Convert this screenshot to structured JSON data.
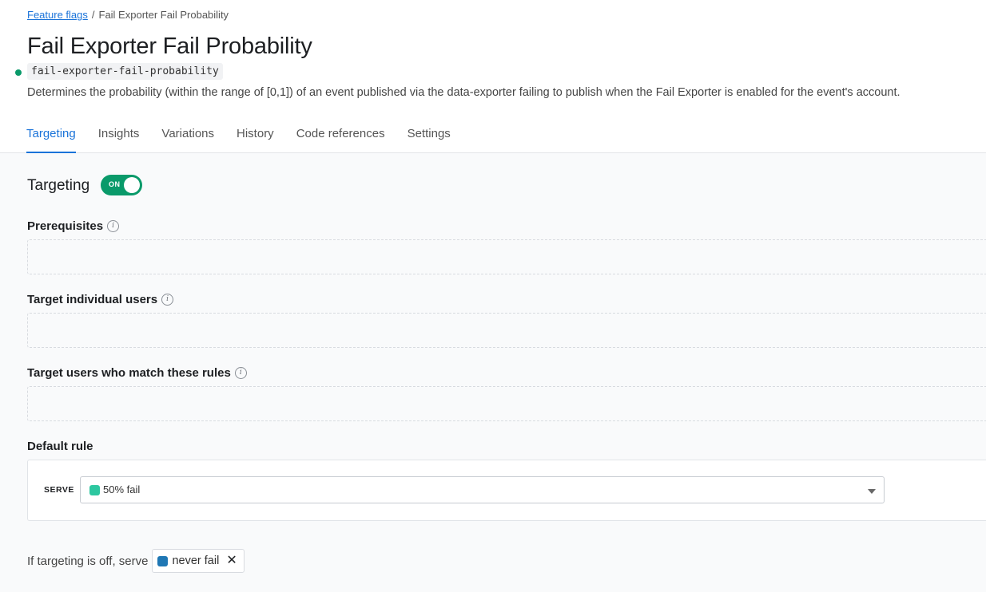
{
  "breadcrumb": {
    "parent": "Feature flags",
    "separator": "/",
    "current": "Fail Exporter Fail Probability"
  },
  "flag": {
    "title": "Fail Exporter Fail Probability",
    "key": "fail-exporter-fail-probability",
    "status_color": "#0a9a6a",
    "description": "Determines the probability (within the range of [0,1]) of an event published via the data-exporter failing to publish when the Fail Exporter is enabled for the event's account."
  },
  "tabs": [
    {
      "label": "Targeting",
      "active": true
    },
    {
      "label": "Insights",
      "active": false
    },
    {
      "label": "Variations",
      "active": false
    },
    {
      "label": "History",
      "active": false
    },
    {
      "label": "Code references",
      "active": false
    },
    {
      "label": "Settings",
      "active": false
    }
  ],
  "targeting": {
    "title": "Targeting",
    "toggle_label": "ON",
    "toggle_on": true
  },
  "sections": {
    "prerequisites": "Prerequisites",
    "individual_users": "Target individual users",
    "rules": "Target users who match these rules",
    "default_rule": "Default rule"
  },
  "default_rule": {
    "serve_label": "SERVE",
    "selected": "50% fail",
    "swatch_color": "#2dc7a0"
  },
  "off_variation": {
    "text": "If targeting is off, serve",
    "value": "never fail",
    "swatch_color": "#1f77b4",
    "remove_glyph": "✕"
  },
  "icons": {
    "info": "i"
  },
  "colors": {
    "accent": "#1a73d9",
    "on": "#0a9a6a"
  }
}
